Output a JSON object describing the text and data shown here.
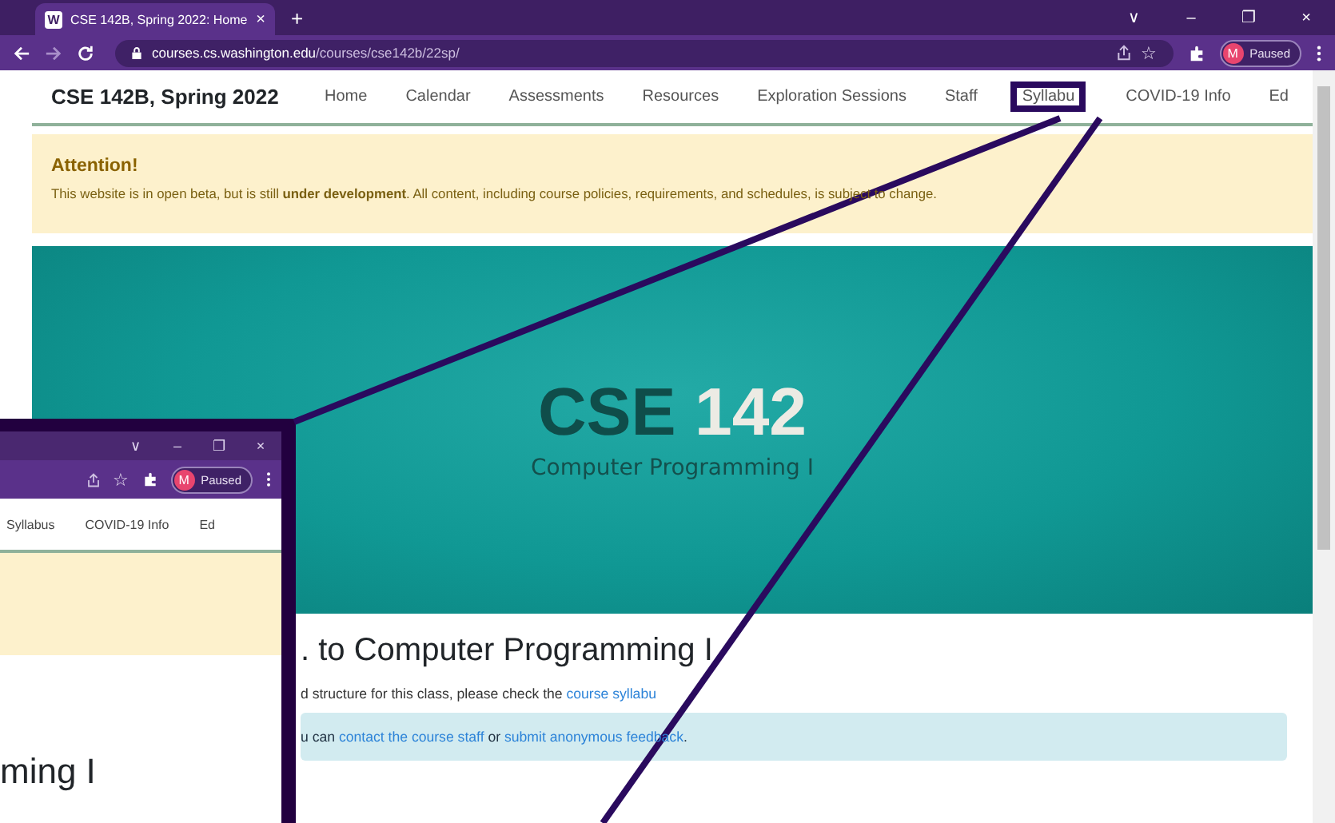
{
  "browser": {
    "tab": {
      "favicon": "W",
      "title": "CSE 142B, Spring 2022: Home",
      "close": "×",
      "new_tab": "+"
    },
    "window_controls": [
      "∨",
      "–",
      "❐",
      "×"
    ],
    "url": {
      "host": "courses.cs.washington.edu",
      "path": "/courses/cse142b/22sp/"
    },
    "bookmark": "☆",
    "profile": {
      "initial": "M",
      "status": "Paused"
    }
  },
  "site": {
    "title": "CSE 142B, Spring 2022",
    "nav": [
      {
        "label": "Home",
        "highlighted": false
      },
      {
        "label": "Calendar",
        "highlighted": false
      },
      {
        "label": "Assessments",
        "highlighted": false
      },
      {
        "label": "Resources",
        "highlighted": false
      },
      {
        "label": "Exploration Sessions",
        "highlighted": false
      },
      {
        "label": "Staff",
        "highlighted": false
      },
      {
        "label": "Syllabu",
        "highlighted": true
      },
      {
        "label": "COVID-19 Info",
        "highlighted": false
      },
      {
        "label": "Ed",
        "highlighted": false
      }
    ],
    "alert": {
      "title": "Attention!",
      "text": "This website is in open beta, but is still **under development**. All content, including course policies, requirements, and schedules, is subject to change."
    },
    "hero": {
      "title_dark": "CSE",
      "title_light": "142",
      "subtitle": "Computer Programming I"
    },
    "heading": ". to Computer Programming I",
    "paragraph": [
      {
        "kind": "text",
        "text": "d structure for this class, please check the "
      },
      {
        "kind": "link",
        "text": "course syllabu"
      }
    ],
    "info": [
      {
        "kind": "text",
        "text": "u can "
      },
      {
        "kind": "link",
        "text": "contact the course staff"
      },
      {
        "kind": "text",
        "text": " or "
      },
      {
        "kind": "link",
        "text": "submit anonymous feedback"
      },
      {
        "kind": "text",
        "text": "."
      }
    ]
  },
  "zoom_inset": {
    "window_controls": [
      "∨",
      "–",
      "❐",
      "×"
    ],
    "bookmark": "☆",
    "profile": {
      "initial": "M",
      "status": "Paused"
    },
    "nav": [
      "Syllabus",
      "COVID-19 Info",
      "Ed"
    ],
    "heading": "ming I"
  }
}
